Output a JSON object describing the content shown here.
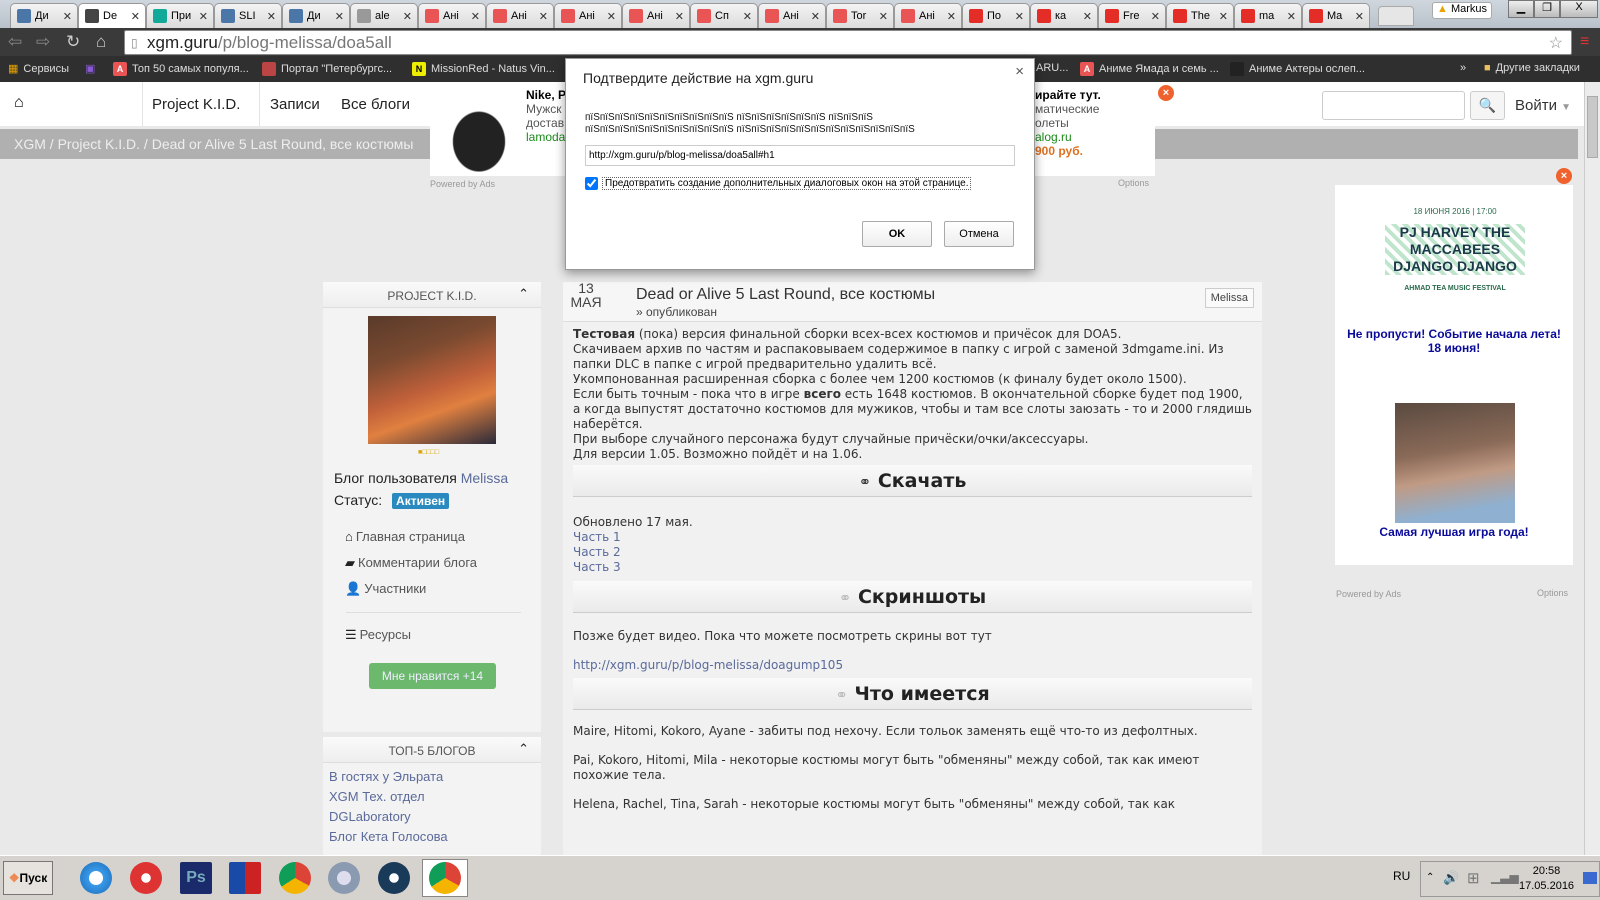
{
  "browser": {
    "tabs": [
      {
        "label": "Ди",
        "icon": "chat-icon",
        "color": "#4a76a8"
      },
      {
        "label": "De",
        "icon": "pattern-icon",
        "color": "#444"
      },
      {
        "label": "При",
        "icon": "play-store-icon",
        "color": "#1a9"
      },
      {
        "label": "SLI",
        "icon": "vk-icon",
        "color": "#4a76a8"
      },
      {
        "label": "Ди",
        "icon": "chat-icon",
        "color": "#4a76a8"
      },
      {
        "label": "ale",
        "icon": "page-icon",
        "color": "#999"
      },
      {
        "label": "Ані",
        "icon": "anime-icon",
        "color": "#e95454"
      },
      {
        "label": "Ані",
        "icon": "anime-icon",
        "color": "#e95454"
      },
      {
        "label": "Ані",
        "icon": "anime-icon",
        "color": "#e95454"
      },
      {
        "label": "Ані",
        "icon": "anime-icon",
        "color": "#e95454"
      },
      {
        "label": "Сп",
        "icon": "anime-icon",
        "color": "#e95454"
      },
      {
        "label": "Ані",
        "icon": "anime-icon",
        "color": "#e95454"
      },
      {
        "label": "Tor",
        "icon": "anime-icon",
        "color": "#e95454"
      },
      {
        "label": "Ані",
        "icon": "anime-icon",
        "color": "#e95454"
      },
      {
        "label": "По",
        "icon": "youtube-icon",
        "color": "#e52d27"
      },
      {
        "label": "ка",
        "icon": "youtube-icon",
        "color": "#e52d27"
      },
      {
        "label": "Fre",
        "icon": "youtube-icon",
        "color": "#e52d27"
      },
      {
        "label": "The",
        "icon": "youtube-icon",
        "color": "#e52d27"
      },
      {
        "label": "ma",
        "icon": "youtube-icon",
        "color": "#e52d27"
      },
      {
        "label": "Ma",
        "icon": "youtube-icon",
        "color": "#e52d27"
      }
    ],
    "profile": "Markus",
    "url_host": "xgm.guru",
    "url_path": "/p/blog-melissa/doa5all",
    "bookmarks": [
      "Сервисы",
      "Топ 50 самых популя...",
      "Портал \"Петербургс...",
      "MissionRed - Natus Vin...",
      "ARU...",
      "Аниме Ямада и семь ...",
      "Аниме Актеры ослеп..."
    ],
    "other_bookmarks": "Другие закладки"
  },
  "site": {
    "nav": [
      "Project K.I.D.",
      "Записи",
      "Все блоги"
    ],
    "login": "Войти",
    "breadcrumb": [
      "XGM",
      "Project K.I.D.",
      "Dead or Alive 5 Last Round, все костюмы"
    ],
    "ad_top": {
      "title_left": "Nike, P",
      "line1": "Мужск",
      "line2": "достав",
      "domain": "lamoda",
      "title_right": "ирайте тут.",
      "r1": "матические",
      "r2": "олеты",
      "r3": "alog.ru",
      "price": "900 руб.",
      "powered": "Powered by Ads",
      "options": "Options"
    }
  },
  "sidebar": {
    "title": "PROJECT K.I.D.",
    "blog_of": "Блог пользователя",
    "user": "Melissa",
    "status_label": "Статус:",
    "status": "Активен",
    "links": [
      "Главная страница",
      "Комментарии блога",
      "Участники",
      "Ресурсы"
    ],
    "like": "Мне нравится +14",
    "top_title": "ТОП-5 БЛОГОВ",
    "top": [
      "В гостях у Эльрата",
      "XGM Тех. отдел",
      "DGLaboratory",
      "Блог Кета Голосова"
    ]
  },
  "post": {
    "day": "13",
    "month": "МАЯ",
    "title": "Dead or Alive 5 Last Round, все костюмы",
    "state": "» опубликован",
    "author": "Melissa",
    "intro_bold": "Тестовая",
    "intro": " (пока) версия финальной сборки всех-всех костюмов и причёсок для DOA5.",
    "l2": "Скачиваем архив по частям и распаковываем содержимое в папку с игрой с заменой 3dmgame.ini. Из папки DLC в папке с игрой предварительно удалить всё.",
    "l3": "Укомпонованная расширенная сборка с более чем 1200 костюмов (к финалу будет около 1500).",
    "l4a": "Если быть точным - пока что в игре ",
    "l4b": "всего",
    "l4c": " есть 1648 костюмов. В окончательной сборке будет под 1900, а когда выпустят достаточно костюмов для мужиков, чтобы и там все слоты заюзать - то и 2000 глядишь наберётся.",
    "l5": "При выборе случайного персонажа будут случайные причёски/очки/аксессуары.",
    "l6": "Для версии 1.05. Возможно пойдёт и на 1.06.",
    "sec1": "Скачать",
    "updated": "Обновлено 17 мая.",
    "parts": [
      "Часть 1",
      "Часть 2",
      "Часть 3"
    ],
    "sec2": "Скриншоты",
    "shots_text": "Позже будет видео. Пока что можете посмотреть скрины вот тут",
    "shots_link": "http://xgm.guru/p/blog-melissa/doagump105",
    "sec3": "Что имеется",
    "p1": "Maire, Hitomi, Kokoro, Ayane - забиты под нехочу. Если тольок заменять ещё что-то из дефолтных.",
    "p2": "Pai, Kokoro, Hitomi, Mila - некоторые костюмы могут быть \"обменяны\" между собой, так как имеют похожие тела.",
    "p3": "Helena, Rachel, Tina, Sarah - некоторые костюмы могут быть \"обменяны\" между собой, так как"
  },
  "right_ad": {
    "poster_date": "18 ИЮНЯ 2016 | 17:00",
    "poster_title": "PJ HARVEY THE MACCABEES DJANGO DJANGO",
    "poster_footer": "AHMAD TEA MUSIC FESTIVAL",
    "caption1": "Не пропусти! Событие начала лета! 18 июня!",
    "caption2": "Самая лучшая игра года!",
    "powered": "Powered by Ads",
    "options": "Options"
  },
  "dialog": {
    "title": "Подтвердите действие на xgm.guru",
    "msg1": "пїЅпїЅпїЅпїЅпїЅпїЅпїЅпїЅпїЅпїЅ пїЅпїЅпїЅпїЅпїЅпїЅ пїЅпїЅпїЅ",
    "msg2": "пїЅпїЅпїЅпїЅпїЅпїЅпїЅпїЅпїЅпїЅ пїЅпїЅпїЅпїЅпїЅпїЅпїЅпїЅпїЅпїЅпїЅпїЅ",
    "input": "http://xgm.guru/p/blog-melissa/doa5all#h1",
    "checkbox": "Предотвратить создание дополнительных диалоговых окон на этой странице.",
    "checked": true,
    "ok": "OK",
    "cancel": "Отмена"
  },
  "taskbar": {
    "start": "Пуск",
    "lang": "RU",
    "time": "20:58",
    "date": "17.05.2016"
  }
}
